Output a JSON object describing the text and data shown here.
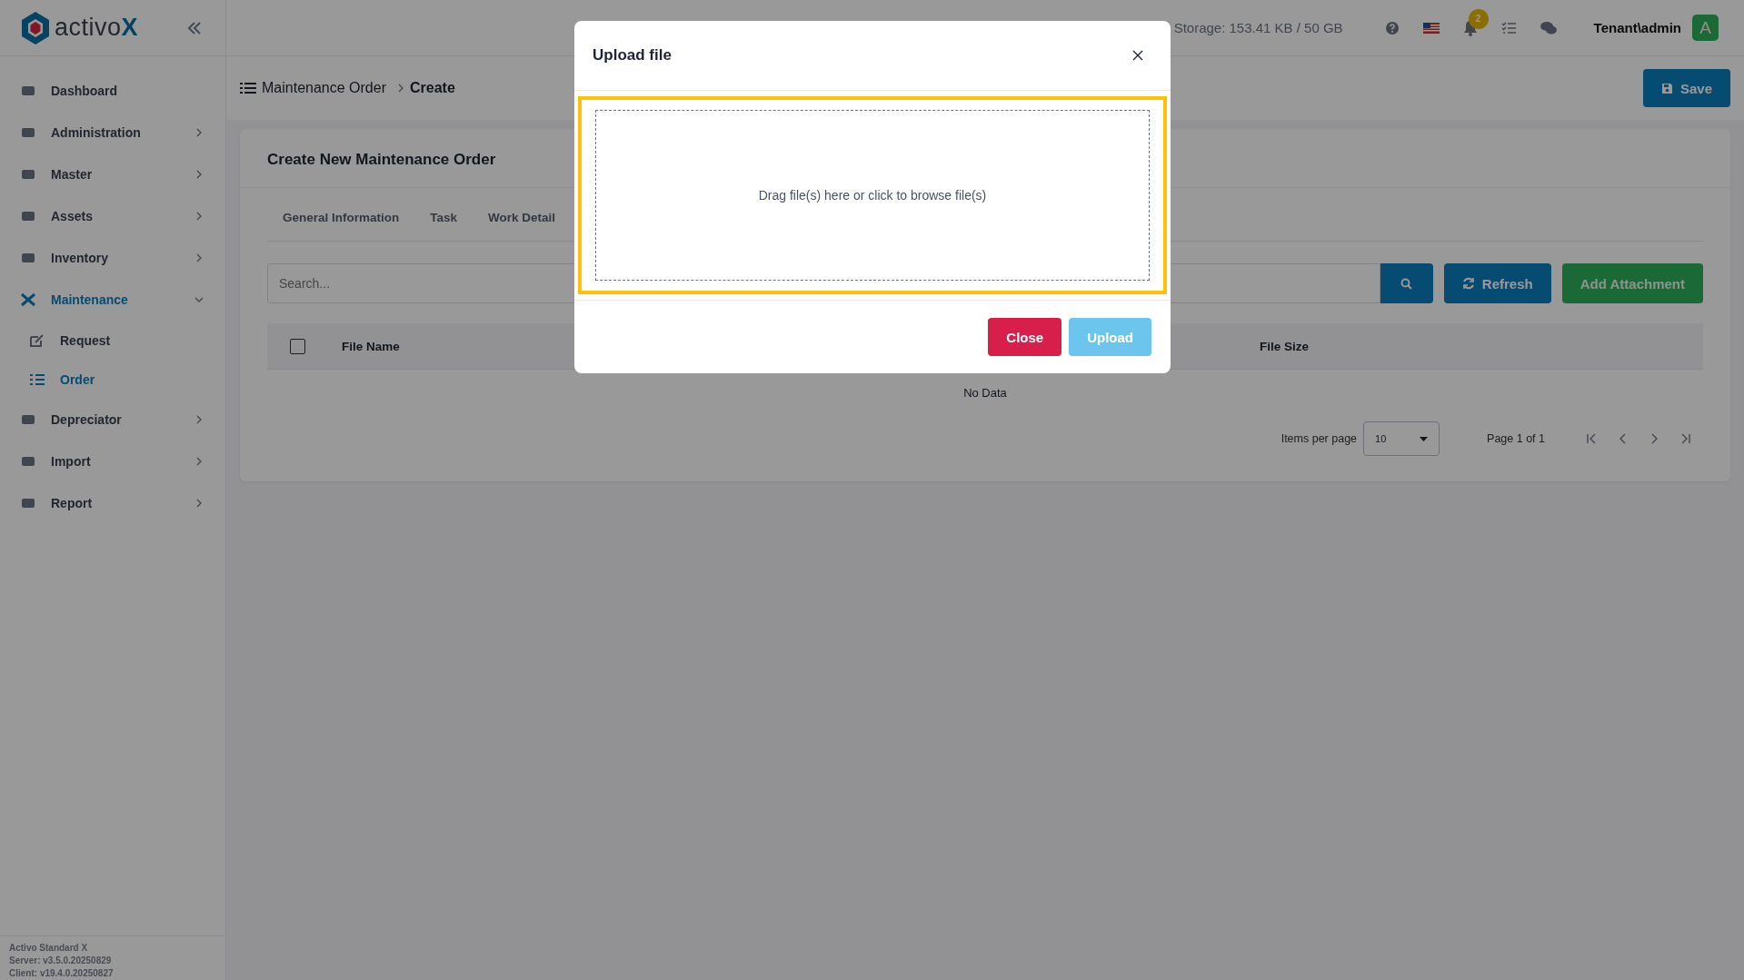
{
  "brand": {
    "name": "activo",
    "accent": "X"
  },
  "sidebar": {
    "items": [
      {
        "label": "Dashboard",
        "selected": false
      },
      {
        "label": "Administration",
        "selected": false,
        "expanded": false
      },
      {
        "label": "Master",
        "selected": false,
        "expanded": false
      },
      {
        "label": "Assets",
        "selected": false,
        "expanded": false
      },
      {
        "label": "Inventory",
        "selected": false,
        "expanded": false
      },
      {
        "label": "Maintenance",
        "selected": true,
        "expanded": true,
        "children": [
          {
            "label": "Request",
            "selected": false
          },
          {
            "label": "Order",
            "selected": true
          }
        ]
      },
      {
        "label": "Depreciator",
        "selected": false,
        "expanded": false
      },
      {
        "label": "Import",
        "selected": false,
        "expanded": false
      },
      {
        "label": "Report",
        "selected": false,
        "expanded": false
      }
    ],
    "footer": [
      "Activo Standard X",
      "Server: v3.5.0.20250829",
      "Client: v19.4.0.20250827"
    ]
  },
  "header": {
    "storage": "Storage: 153.41 KB / 50 GB",
    "notification_count": "2",
    "user": "Tenant\\admin",
    "avatar": "A"
  },
  "breadcrumb": [
    "Maintenance Order",
    "Create"
  ],
  "save_button": "Save",
  "card": {
    "title": "Create New Maintenance Order",
    "tabs": [
      {
        "label": "General Information",
        "selected": false
      },
      {
        "label": "Task",
        "selected": false
      },
      {
        "label": "Work Detail",
        "selected": false
      }
    ],
    "search": {
      "placeholder": "Search..."
    },
    "refresh_button": "Refresh",
    "add_button": "Add Attachment",
    "table": {
      "select_all_checked": false,
      "columns": [
        "File Name",
        "File Size"
      ],
      "empty": "No Data"
    },
    "pagination": {
      "items_per_page_label": "Items per page",
      "page_size": "10",
      "page_info": "Page 1 of 1"
    }
  },
  "modal": {
    "title": "Upload file",
    "dropzone": "Drag file(s) here or click to browse file(s)",
    "close_button": "Close",
    "upload_button": "Upload",
    "upload_disabled": true
  }
}
